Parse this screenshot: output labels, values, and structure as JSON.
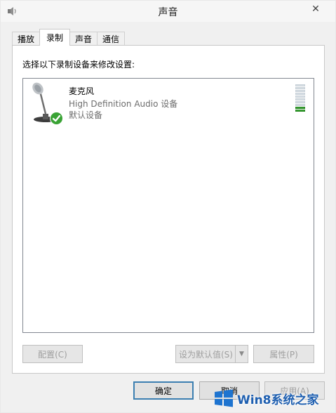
{
  "window": {
    "title": "声音",
    "close_glyph": "✕"
  },
  "tabs": [
    {
      "label": "播放",
      "active": false
    },
    {
      "label": "录制",
      "active": true
    },
    {
      "label": "声音",
      "active": false
    },
    {
      "label": "通信",
      "active": false
    }
  ],
  "panel": {
    "instruction": "选择以下录制设备来修改设置:"
  },
  "devices": [
    {
      "name": "麦克风",
      "description": "High Definition Audio 设备",
      "status": "默认设备",
      "icon": "microphone-icon",
      "default_badge": "checkmark-icon",
      "level_fraction": 0.2
    }
  ],
  "buttons": {
    "configure": "配置(C)",
    "set_default": "设为默认值(S)",
    "set_default_arrow": "▼",
    "properties": "属性(P)",
    "ok": "确定",
    "cancel": "取消",
    "apply": "应用(A)"
  },
  "watermark": {
    "text": "Win8系统之家",
    "logo": "windows-logo-icon"
  },
  "colors": {
    "accent_green": "#3aa335",
    "default_button_border": "#3c7fb1",
    "watermark_blue": "#1e5fb0"
  }
}
